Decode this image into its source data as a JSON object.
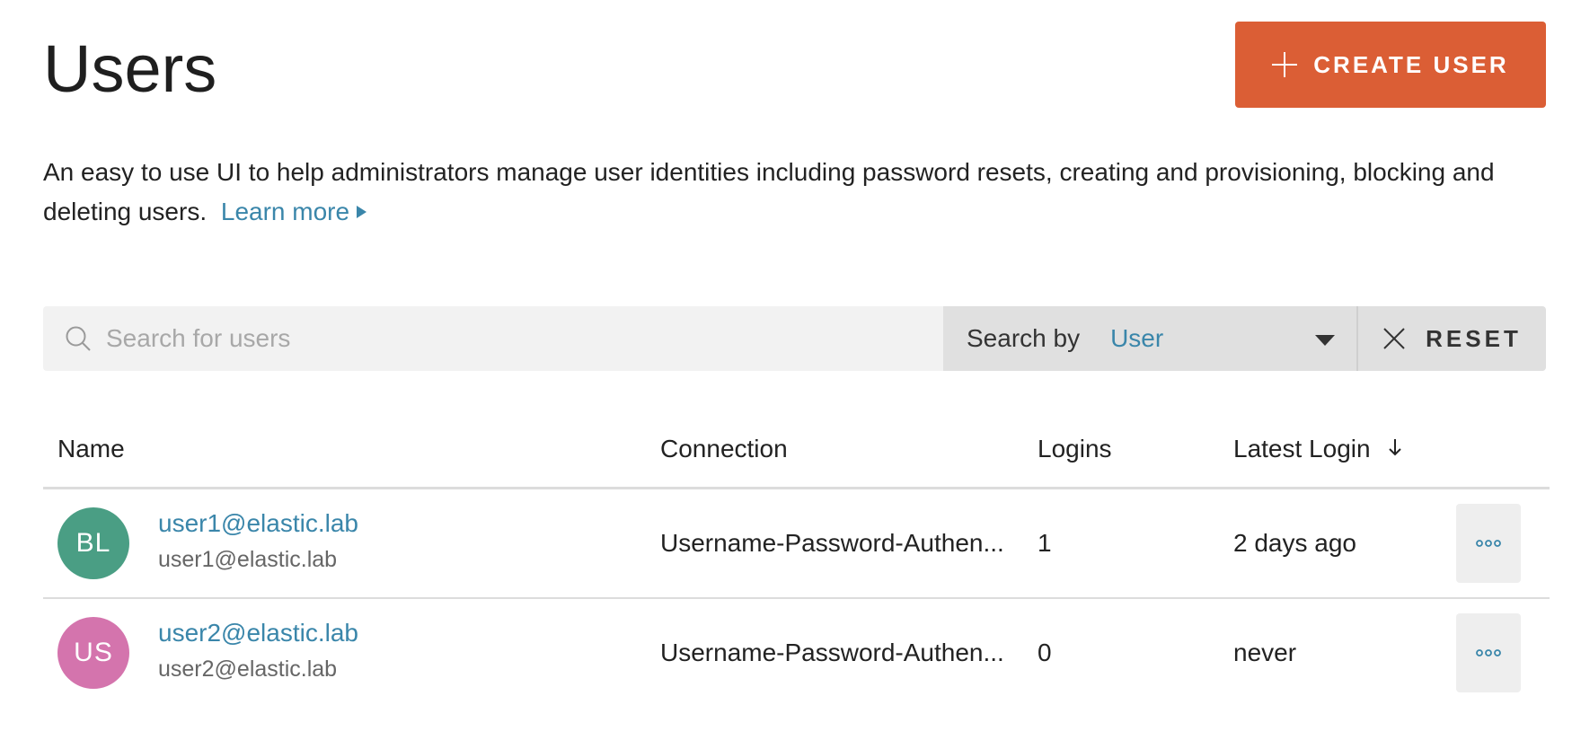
{
  "header": {
    "title": "Users",
    "create_button_label": "CREATE USER"
  },
  "description": {
    "text": "An easy to use UI to help administrators manage user identities including password resets, creating and provisioning, blocking and deleting users.",
    "learn_more": "Learn more"
  },
  "search": {
    "placeholder": "Search for users",
    "value": "",
    "search_by_label": "Search by",
    "search_by_value": "User",
    "reset_label": "RESET"
  },
  "table": {
    "columns": {
      "name": "Name",
      "connection": "Connection",
      "logins": "Logins",
      "latest_login": "Latest Login"
    },
    "rows": [
      {
        "initials": "BL",
        "avatar_color": "#4a9e84",
        "name": "user1@elastic.lab",
        "email": "user1@elastic.lab",
        "connection": "Username-Password-Authen...",
        "logins": "1",
        "latest_login": "2 days ago"
      },
      {
        "initials": "US",
        "avatar_color": "#d474ad",
        "name": "user2@elastic.lab",
        "email": "user2@elastic.lab",
        "connection": "Username-Password-Authen...",
        "logins": "0",
        "latest_login": "never"
      }
    ]
  },
  "colors": {
    "accent": "#db5e35",
    "link": "#3a86aa"
  }
}
